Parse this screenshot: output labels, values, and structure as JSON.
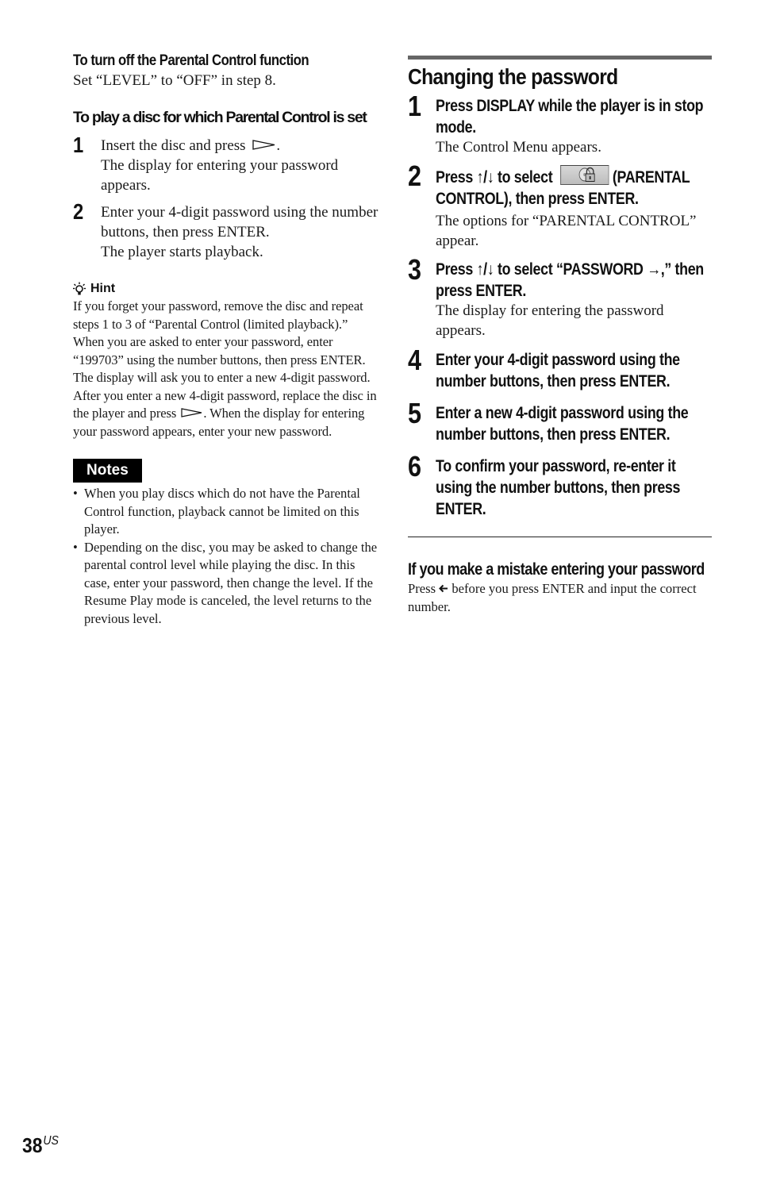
{
  "left": {
    "turn_off": {
      "heading": "To turn off the Parental Control function",
      "text": "Set “LEVEL” to “OFF” in step 8."
    },
    "play_disc": {
      "heading": "To play a disc for which Parental Control is set",
      "steps": [
        {
          "num": "1",
          "lines": [
            "Insert the disc and press",
            "The display for entering your password appears."
          ],
          "icon": "play-icon"
        },
        {
          "num": "2",
          "lines": [
            "Enter your 4-digit password using the number buttons, then press ENTER.",
            "The player starts playback."
          ]
        }
      ]
    },
    "hint": {
      "title": "Hint",
      "icon": "lightbulb-icon",
      "text_part1": "If you forget your password, remove the disc and repeat steps 1 to 3 of “Parental Control (limited playback).” When you are asked to enter your password, enter “199703” using the number buttons, then press ENTER. The display will ask you to enter a new 4-digit password. After you enter a new 4-digit password, replace the disc in the player and press",
      "text_part2": ". When the display for entering your password appears, enter your new password."
    },
    "notes": {
      "title": "Notes",
      "items": [
        "When you play discs which do not have the Parental Control function, playback cannot be limited on this player.",
        "Depending on the disc, you may be asked to change the parental control level while playing the disc. In this case, enter your password, then change the level. If the Resume Play mode is canceled, the level returns to the previous level."
      ]
    }
  },
  "right": {
    "title": "Changing the password",
    "steps": [
      {
        "num": "1",
        "bold": "Press DISPLAY while the player is in stop mode.",
        "text": "The Control Menu appears."
      },
      {
        "num": "2",
        "bold_pre": "Press ↑/↓ to select",
        "bold_post": "(PARENTAL CONTROL), then press ENTER.",
        "icon": "parental-control-lock-icon",
        "text": "The options for “PARENTAL CONTROL” appear."
      },
      {
        "num": "3",
        "bold": "Press ↑/↓ to select “PASSWORD →,” then press ENTER.",
        "text": "The display for entering the password appears."
      },
      {
        "num": "4",
        "bold": "Enter your 4-digit password using the number buttons, then press ENTER."
      },
      {
        "num": "5",
        "bold": "Enter a new 4-digit password using the number buttons, then press ENTER."
      },
      {
        "num": "6",
        "bold": "To confirm your password, re-enter it using the number buttons, then press ENTER."
      }
    ],
    "mistake": {
      "heading": "If you make a mistake entering your password",
      "text_pre": "Press",
      "icon": "back-arrow-icon",
      "text_post": "before you press ENTER and input the correct number."
    }
  },
  "footer": {
    "page_number": "38",
    "region": "US"
  }
}
